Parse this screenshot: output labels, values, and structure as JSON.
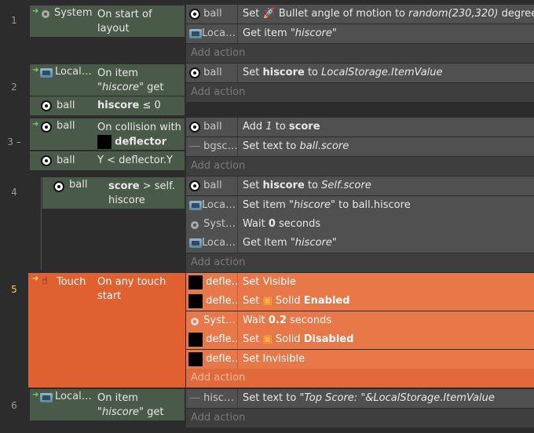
{
  "events": [
    {
      "num": "1",
      "cond_obj": "System",
      "cond_text": "On start of layout",
      "actions": [
        {
          "obj": "ball",
          "text_pre": "Set",
          "text_rest": "Bullet angle of motion to ",
          "text_italic": "random(230,320)",
          "text_tail": " degrees"
        },
        {
          "obj": "Loca…",
          "text": "Get item ",
          "italic": "\"hiscore\""
        }
      ],
      "add": "Add action"
    },
    {
      "num": "2",
      "cond_obj": "Local…",
      "cond_text1": "On item",
      "cond_italic": "\"hiscore\"",
      "cond_text2": " get",
      "cond2_obj": "ball",
      "cond2_b": "hiscore",
      "cond2_rest": " ≤ 0",
      "actions": [
        {
          "obj": "ball",
          "pre": "Set ",
          "b": "hiscore",
          "mid": " to ",
          "italic": "LocalStorage.ItemValue"
        }
      ],
      "add": "Add action"
    },
    {
      "num": "3",
      "cond_obj": "ball",
      "cond_text": "On collision with",
      "cond_b": "deflector",
      "cond2_obj": "ball",
      "cond2_text": "Y < deflector.Y",
      "actions": [
        {
          "obj": "ball",
          "pre": "Add ",
          "italic": "1",
          "mid": " to ",
          "b": "score"
        },
        {
          "obj": "bgsc…",
          "pre": "Set text to ",
          "italic": "ball.score"
        }
      ],
      "add": "Add action"
    },
    {
      "num": "4",
      "cond_obj": "ball",
      "cond_b": "score",
      "cond_rest": " > self.",
      "cond_rest2": "hiscore",
      "actions": [
        {
          "obj": "ball",
          "pre": "Set ",
          "b": "hiscore",
          "mid": " to ",
          "italic": "Self.score"
        },
        {
          "obj": "Loca…",
          "pre": "Set item ",
          "italic": "\"hiscore\"",
          "mid": " to ball.hiscore"
        },
        {
          "obj": "Syst…",
          "pre": "Wait ",
          "b": "0",
          "mid": " seconds"
        },
        {
          "obj": "Loca…",
          "pre": "Get item ",
          "italic": "\"hiscore\""
        }
      ],
      "add": "Add action"
    },
    {
      "num": "5",
      "cond_obj": "Touch",
      "cond_text": "On any touch start",
      "actions": [
        {
          "obj": "defle…",
          "text": "Set Visible"
        },
        {
          "obj": "defle…",
          "pre": "Set ",
          "mid": "Solid ",
          "b": "Enabled"
        },
        {
          "obj": "Syst…",
          "pre": "Wait ",
          "b": "0.2",
          "mid": " seconds"
        },
        {
          "obj": "defle…",
          "pre": "Set ",
          "mid": "Solid ",
          "b": "Disabled"
        },
        {
          "obj": "defle…",
          "text": "Set Invisible"
        }
      ],
      "add": "Add action"
    },
    {
      "num": "6",
      "cond_obj": "Local…",
      "cond_text1": "On item",
      "cond_italic": "\"hiscore\"",
      "cond_text2": " get",
      "actions": [
        {
          "obj": "hisc…",
          "pre": "Set text to ",
          "italic": "\"Top Score: \"&LocalStorage.ItemValue"
        }
      ],
      "add": "Add action"
    }
  ],
  "colors": {
    "selected": "#e06030",
    "condition": "#4a5a48",
    "action": "#505050"
  }
}
